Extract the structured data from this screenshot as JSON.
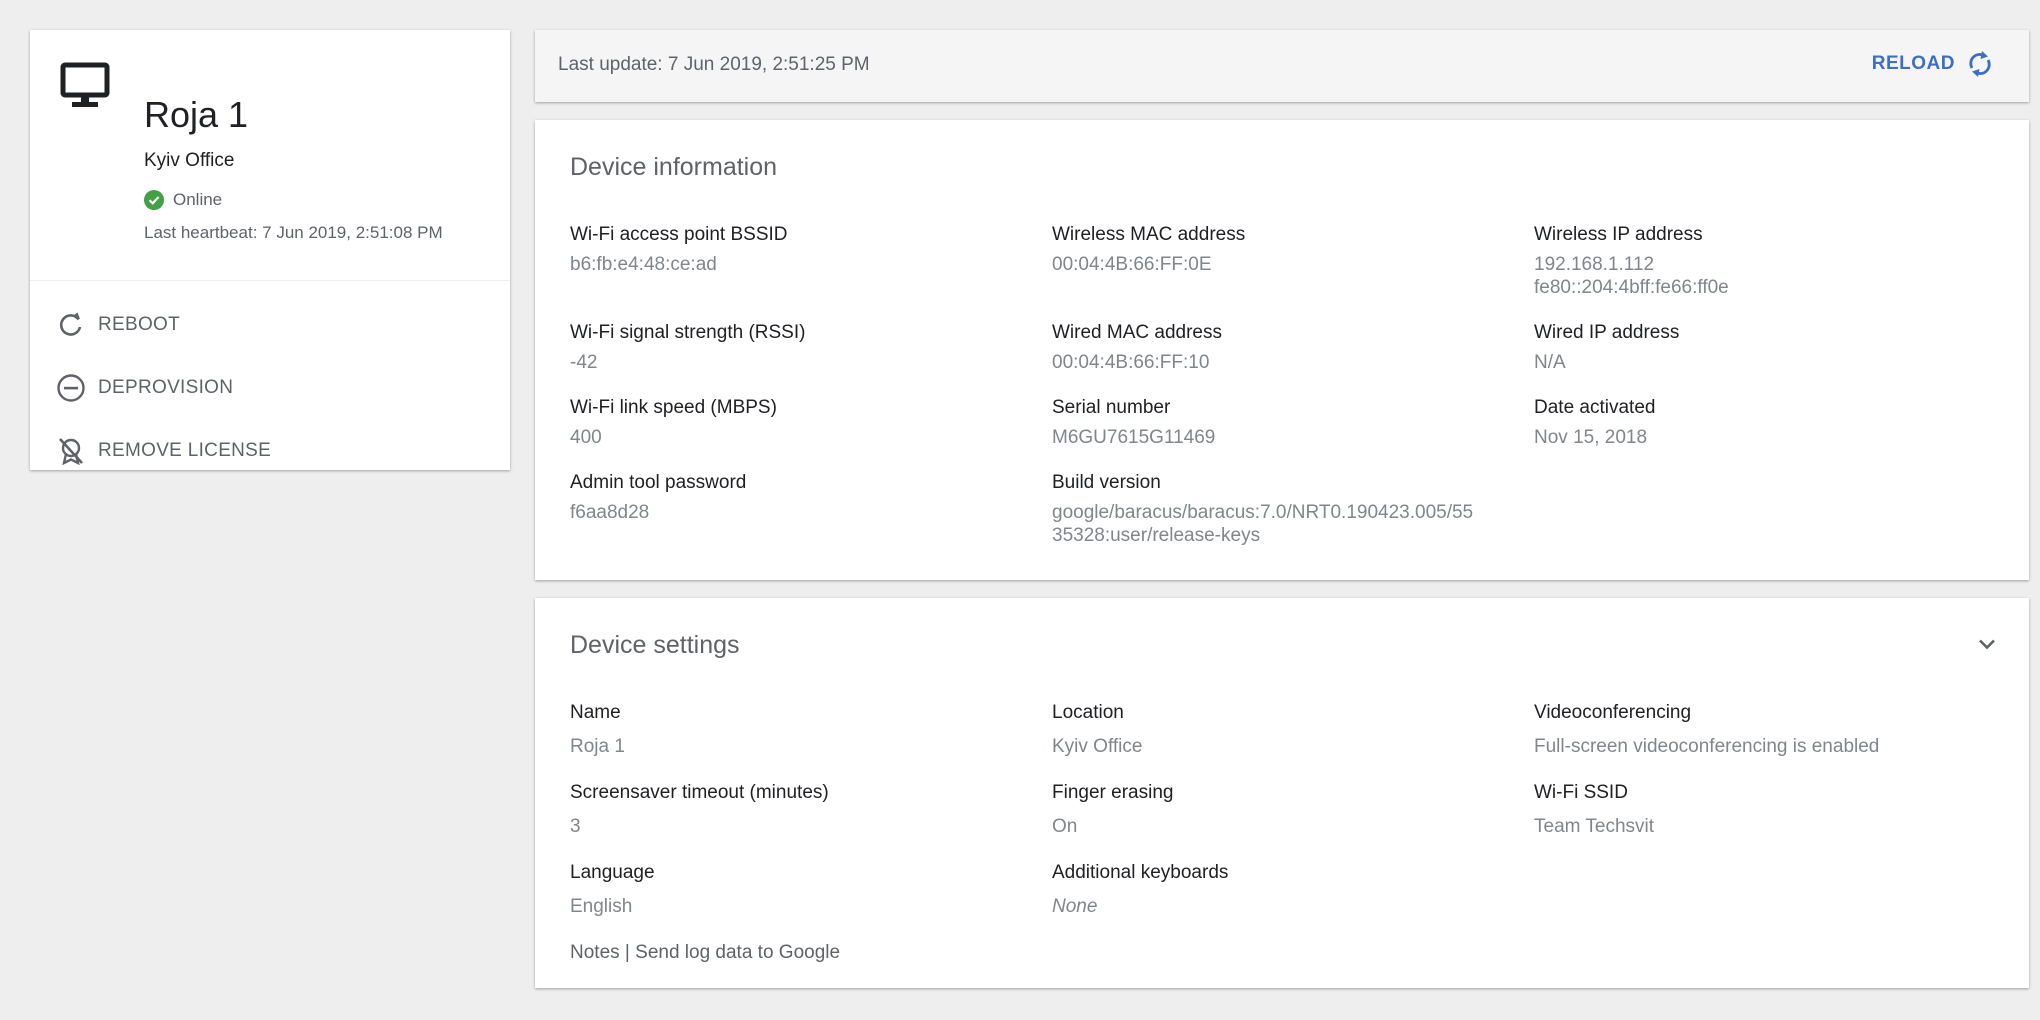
{
  "device": {
    "name": "Roja 1",
    "location": "Kyiv Office",
    "status": "Online",
    "heartbeat": "Last heartbeat: 7 Jun 2019, 2:51:08 PM",
    "icon": "monitor-icon"
  },
  "actions": {
    "reboot": "REBOOT",
    "deprovision": "DEPROVISION",
    "remove_license": "REMOVE LICENSE"
  },
  "update_bar": {
    "last_update": "Last update: 7 Jun 2019, 2:51:25 PM",
    "reload": "RELOAD"
  },
  "info": {
    "title": "Device information",
    "bssid_label": "Wi-Fi access point BSSID",
    "bssid": "b6:fb:e4:48:ce:ad",
    "wmac_label": "Wireless MAC address",
    "wmac": "00:04:4B:66:FF:0E",
    "wip_label": "Wireless IP address",
    "wip_v4": "192.168.1.112",
    "wip_v6": "fe80::204:4bff:fe66:ff0e",
    "rssi_label": "Wi-Fi signal strength (RSSI)",
    "rssi": "-42",
    "wdmac_label": "Wired MAC address",
    "wdmac": "00:04:4B:66:FF:10",
    "wdip_label": "Wired IP address",
    "wdip": "N/A",
    "speed_label": "Wi-Fi link speed (MBPS)",
    "speed": "400",
    "serial_label": "Serial number",
    "serial": "M6GU7615G11469",
    "activated_label": "Date activated",
    "activated": "Nov 15, 2018",
    "admin_label": "Admin tool password",
    "admin": "f6aa8d28",
    "build_label": "Build version",
    "build_1": "google/baracus/baracus:7.0/NRT0.190423.005/55",
    "build_2": "35328:user/release-keys"
  },
  "settings": {
    "title": "Device settings",
    "name_label": "Name",
    "name": "Roja 1",
    "location_label": "Location",
    "location": "Kyiv Office",
    "video_label": "Videoconferencing",
    "video": "Full-screen videoconferencing is enabled",
    "screensaver_label": "Screensaver timeout (minutes)",
    "screensaver": "3",
    "finger_label": "Finger erasing",
    "finger": "On",
    "ssid_label": "Wi-Fi SSID",
    "ssid": "Team Techsvit",
    "language_label": "Language",
    "language": "English",
    "keyboards_label": "Additional keyboards",
    "keyboards": "None",
    "notes_link": "Notes",
    "separator": " | ",
    "log_link": "Send log data to Google"
  },
  "colors": {
    "online": "#43a047",
    "reload": "#3f6fc4",
    "background": "#eeeeee"
  }
}
